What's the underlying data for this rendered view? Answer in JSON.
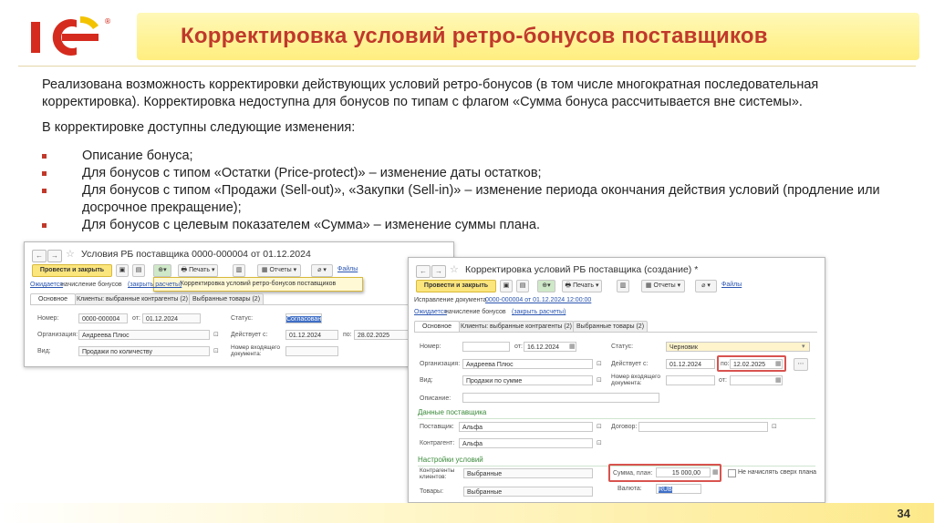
{
  "header": {
    "logo_text": "1С",
    "title": "Корректировка условий ретро-бонусов поставщиков"
  },
  "body": {
    "intro": "Реализована возможность корректировки действующих условий ретро-бонусов (в том числе многократная последовательная корректировка). Корректировка недоступна для бонусов по типам с флагом «Сумма бонуса рассчитывается вне системы».",
    "changes_intro": "В корректировке доступны следующие изменения:",
    "bullets": [
      "Описание бонуса;",
      "Для бонусов с типом «Остатки (Price-protect)» – изменение даты остатков;",
      "Для бонусов с типом «Продажи (Sell-out)», «Закупки (Sell-in)» – изменение периода окончания действия условий (продление или досрочное прекращение);",
      "Для бонусов с целевым показателем «Сумма» – изменение суммы плана."
    ]
  },
  "window1": {
    "title": "Условия РБ поставщика 0000-000004 от 01.12.2024",
    "buttons": {
      "post_close": "Провести и закрыть",
      "print": "Печать",
      "reports": "Отчеты",
      "files": "Файлы"
    },
    "popup_item": "Корректировка условий ретро-бонусов поставщиков",
    "awaiting": "Ожидается",
    "awaiting_text": "начисление бонусов",
    "calc_link": "(закрыть расчеты)",
    "tabs": [
      "Основное",
      "Клиенты: выбранные контрагенты (2)",
      "Выбранные товары (2)"
    ],
    "fields": {
      "number_label": "Номер:",
      "number": "0000-000004",
      "from_label": "от:",
      "date": "01.12.2024",
      "status_label": "Статус:",
      "status": "Согласован",
      "org_label": "Организация:",
      "org": "Андреева Плюс",
      "valid_label": "Действует с:",
      "valid_from": "01.12.2024",
      "to_label": "по:",
      "valid_to": "28.02.2025",
      "kind_label": "Вид:",
      "kind": "Продажи по количеству",
      "incoming_label": "Номер входящего документа:"
    }
  },
  "window2": {
    "title": "Корректировка условий РБ поставщика (создание) *",
    "buttons": {
      "post_close": "Провести и закрыть",
      "print": "Печать",
      "reports": "Отчеты",
      "files": "Файлы"
    },
    "correction_text": "Исправление документа",
    "correction_link": "0000-000004 от 01.12.2024 12:00:00",
    "awaiting": "Ожидается",
    "awaiting_text": "начисление бонусов",
    "calc_link": "(закрыть расчеты)",
    "tabs": [
      "Основное",
      "Клиенты: выбранные контрагенты (2)",
      "Выбранные товары (2)"
    ],
    "fields": {
      "number_label": "Номер:",
      "from_label": "от:",
      "date": "16.12.2024",
      "status_label": "Статус:",
      "status": "Черновик",
      "org_label": "Организация:",
      "org": "Андреева Плюс",
      "valid_label": "Действует с:",
      "valid_from": "01.12.2024",
      "to_label": "по:",
      "valid_to": "12.02.2025",
      "kind_label": "Вид:",
      "kind": "Продажи по сумме",
      "incoming_label": "Номер входящего документа:",
      "to2_label": "от:",
      "description_label": "Описание:"
    },
    "supplier_section": "Данные поставщика",
    "supplier": {
      "supplier_label": "Поставщик:",
      "supplier": "Альфа",
      "contract_label": "Договор:",
      "counterparty_label": "Контрагент:",
      "counterparty": "Альфа"
    },
    "conditions_section": "Настройки условий",
    "conditions": {
      "clients_label": "Контрагенты клиентов:",
      "clients": "Выбранные",
      "plan_label": "Сумма, план:",
      "plan": "15 000,00",
      "no_accrue": "Не начислять сверх плана",
      "goods_label": "Товары:",
      "goods": "Выбранные",
      "currency_label": "Валюта:",
      "currency": "RUB"
    }
  },
  "footer": {
    "page": "34"
  },
  "colors": {
    "title_red": "#c0392b",
    "accent_yellow": "#fff39a",
    "link_blue": "#2a55b0",
    "section_green": "#3a8a3a",
    "highlight_red": "#d9534f"
  }
}
